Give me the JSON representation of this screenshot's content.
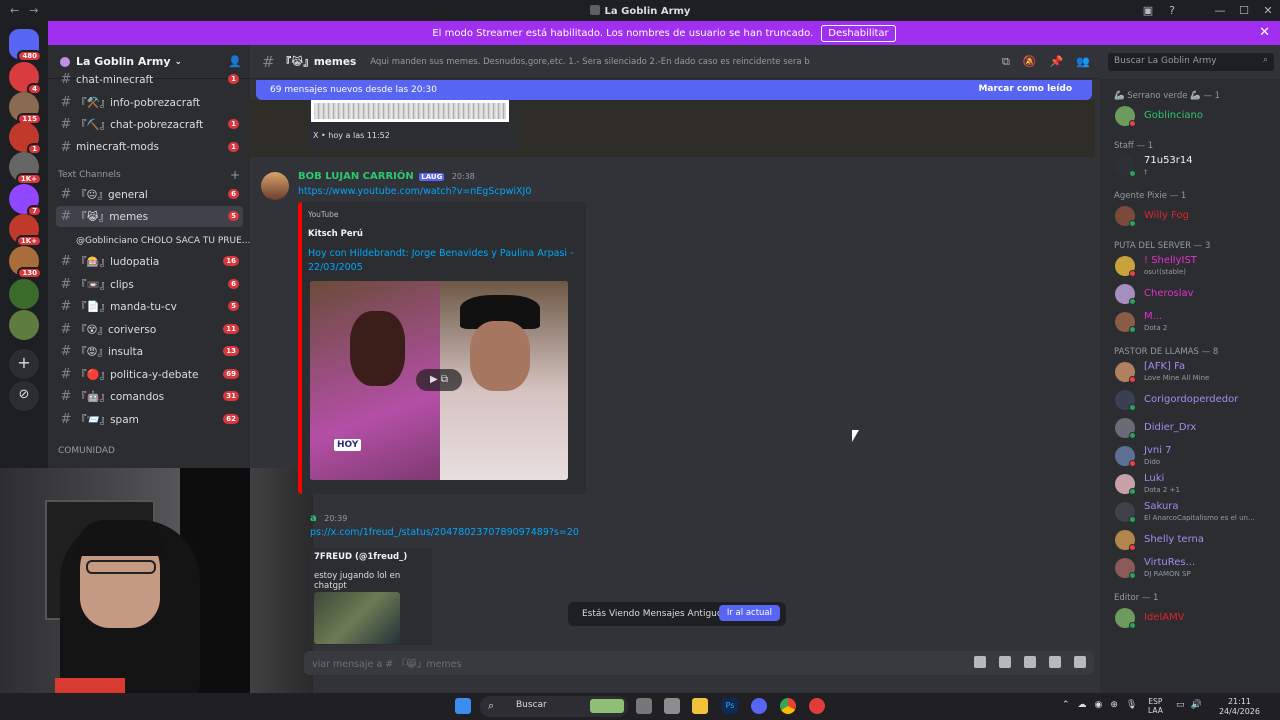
{
  "window": {
    "title": "La Goblin Army"
  },
  "banner": {
    "text": "El modo Streamer está habilitado. Los nombres de usuario se han truncado.",
    "button": "Deshabilitar"
  },
  "server_rail": {
    "badges": [
      "480",
      "4",
      "115",
      "1",
      "1K+",
      "7",
      "1K+",
      "130"
    ]
  },
  "sidebar": {
    "server_name": "La Goblin Army",
    "channels_top": [
      {
        "label": "chat-minecraft",
        "badge": "1"
      },
      {
        "label": "『⚒️』info-pobrezacraft",
        "badge": ""
      },
      {
        "label": "『⛏️』chat-pobrezacraft",
        "badge": "1"
      },
      {
        "label": "minecraft-mods",
        "badge": "1"
      }
    ],
    "category_text": "Text Channels",
    "channels": [
      {
        "label": "『😐』general",
        "badge": "6"
      },
      {
        "label": "『😹』memes",
        "badge": "5",
        "selected": true
      },
      {
        "label": "@Goblinciano CHOLO SACA TU PRUE...",
        "badge": ""
      },
      {
        "label": "『🎰』ludopatia",
        "badge": "16"
      },
      {
        "label": "『📼』clips",
        "badge": "6"
      },
      {
        "label": "『📄』manda-tu-cv",
        "badge": "5"
      },
      {
        "label": "『😵』coriverso",
        "badge": "11"
      },
      {
        "label": "『😡』insulta",
        "badge": "13"
      },
      {
        "label": "『🔴』politica-y-debate",
        "badge": "69"
      },
      {
        "label": "『🤖』comandos",
        "badge": "31"
      },
      {
        "label": "『📨』spam",
        "badge": "62"
      }
    ],
    "category_community": "COMUNIDAD"
  },
  "channel_header": {
    "name": "『😹』memes",
    "topic": "Aqui manden sus memes. Desnudos,gore,etc. 1.- Sera silenciado 2.-En dado caso es reincidente sera baneado",
    "search_placeholder": "Buscar La Goblin Army"
  },
  "new_messages_bar": {
    "text": "69 mensajes nuevos desde las 20:30",
    "action": "Marcar como leído"
  },
  "messages": [
    {
      "embed_footer": "X • hoy a las 11:52"
    },
    {
      "author": "BOB LUJAN CARRIÓN",
      "tag": "LAUG",
      "time": "20:38",
      "link": "https://www.youtube.com/watch?v=nEgScpwiXJ0",
      "embed": {
        "provider": "YouTube",
        "author": "Kitsch Perú",
        "title": "Hoy con Hildebrandt: Jorge Benavides y Paulina Arpasi - 22/03/2005",
        "video_overlay": "HOY"
      }
    },
    {
      "author": "a",
      "time": "20:39",
      "link": "ps://x.com/1freud_/status/2047802370789097489?s=20",
      "embed": {
        "author": "7FREUD (@1freud_)",
        "description": "estoy jugando lol en chatgpt"
      }
    }
  ],
  "old_messages_pill": {
    "text": "Estás Viendo Mensajes Antiguos",
    "button": "Ir al actual"
  },
  "composer": {
    "placeholder": "viar mensaje a # 『😹』memes"
  },
  "members": [
    {
      "category": "🦾 Serrano verde 🦾 — 1",
      "items": [
        {
          "name": "Goblinciano",
          "color": "#2dc770",
          "sub": ""
        }
      ]
    },
    {
      "category": "Staff — 1",
      "items": [
        {
          "name": "71u53r14",
          "color": "#f2f3f5",
          "sub": "†"
        }
      ]
    },
    {
      "category": "Agente Pixie — 1",
      "items": [
        {
          "name": "Willy Fog",
          "color": "#e0242b",
          "sub": ""
        }
      ]
    },
    {
      "category": "PUTA DEL SERVER — 3",
      "items": [
        {
          "name": "! ShellyIST",
          "color": "#e82fcf",
          "sub": "osu!(stable)"
        },
        {
          "name": "Cheroslav",
          "color": "#e82fcf",
          "sub": ""
        },
        {
          "name": "M...",
          "color": "#e82fcf",
          "sub": "Dota 2"
        }
      ]
    },
    {
      "category": "PASTOR DE LLAMAS — 8",
      "items": [
        {
          "name": "[AFK] Fa",
          "color": "#a58cf0",
          "sub": "Love Mine All Mine"
        },
        {
          "name": "Corigordoperdedor",
          "color": "#a58cf0",
          "sub": ""
        },
        {
          "name": "Didier_Drx",
          "color": "#a58cf0",
          "sub": ""
        },
        {
          "name": "Jvni 7",
          "color": "#a58cf0",
          "sub": "Dido"
        },
        {
          "name": "Luki",
          "color": "#a58cf0",
          "sub": "Dota 2 +1"
        },
        {
          "name": "Sakura",
          "color": "#a58cf0",
          "sub": "El AnarcoCapitalismo es el un..."
        },
        {
          "name": "Shelly terna",
          "color": "#a58cf0",
          "sub": ""
        },
        {
          "name": "VirtuRes...",
          "color": "#a58cf0",
          "sub": "DJ RAMON SP"
        }
      ]
    },
    {
      "category": "Editor — 1",
      "items": [
        {
          "name": "IdelAMV",
          "color": "#e0242b",
          "sub": ""
        }
      ]
    }
  ],
  "taskbar": {
    "search": "Buscar",
    "lang1": "ESP",
    "lang2": "LAA",
    "time": "21:11",
    "date": "24/4/2026"
  }
}
